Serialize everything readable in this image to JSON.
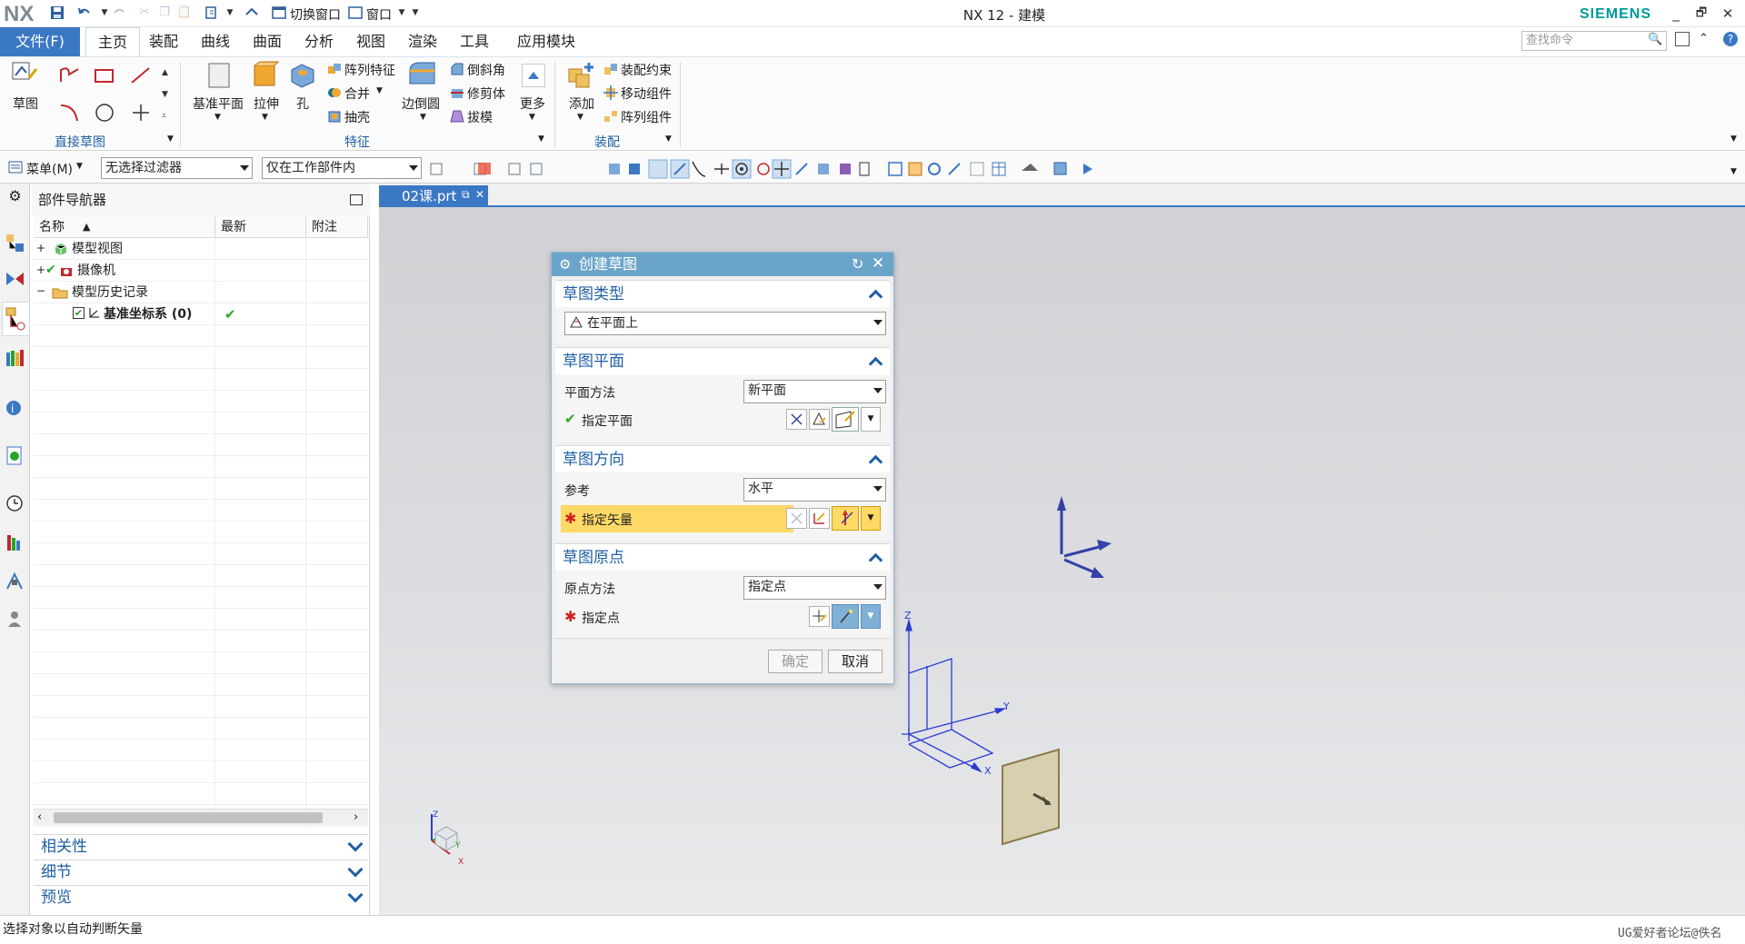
{
  "app": {
    "logo": "NX",
    "title": "NX 12 - 建模",
    "brand": "SIEMENS"
  },
  "quick_access": {
    "switch_window": "切换窗口",
    "window": "窗口"
  },
  "menu_tabs": {
    "file": "文件(F)",
    "items": [
      "主页",
      "装配",
      "曲线",
      "曲面",
      "分析",
      "视图",
      "渲染",
      "工具",
      "应用模块"
    ]
  },
  "search": {
    "placeholder": "查找命令"
  },
  "ribbon": {
    "sketch": {
      "label": "草图"
    },
    "direct_sketch": {
      "label": "直接草图"
    },
    "feature": {
      "label": "特征",
      "datum_plane": "基准平面",
      "extrude": "拉伸",
      "hole": "孔",
      "pattern_feature": "阵列特征",
      "unite": "合并",
      "shell": "抽壳",
      "edge_blend": "边倒圆",
      "chamfer": "倒斜角",
      "trim_body": "修剪体",
      "draft": "拔模",
      "more": "更多"
    },
    "assembly": {
      "label": "装配",
      "add": "添加",
      "assembly_constraint": "装配约束",
      "move_component": "移动组件",
      "pattern_component": "阵列组件"
    }
  },
  "selection_bar": {
    "menu": "菜单(M)",
    "filter": "无选择过滤器",
    "scope": "仅在工作部件内"
  },
  "navigator": {
    "title": "部件导航器",
    "columns": [
      "名称",
      "最新",
      "附注"
    ],
    "items": [
      {
        "label": "模型视图"
      },
      {
        "label": "摄像机"
      },
      {
        "label": "模型历史记录"
      },
      {
        "label": "基准坐标系 (0)"
      }
    ],
    "sections": [
      "相关性",
      "细节",
      "预览"
    ]
  },
  "doc_tab": {
    "label": "02课.prt"
  },
  "dialog": {
    "title": "创建草图",
    "sketch_type": {
      "header": "草图类型",
      "value": "在平面上"
    },
    "sketch_plane": {
      "header": "草图平面",
      "method_label": "平面方法",
      "method_value": "新平面",
      "specify_plane": "指定平面"
    },
    "sketch_orientation": {
      "header": "草图方向",
      "reference_label": "参考",
      "reference_value": "水平",
      "specify_vector": "指定矢量"
    },
    "sketch_origin": {
      "header": "草图原点",
      "method_label": "原点方法",
      "method_value": "指定点",
      "specify_point": "指定点"
    },
    "ok": "确定",
    "cancel": "取消"
  },
  "triad": {
    "z": "Z",
    "y": "Y",
    "x": "X"
  },
  "status": {
    "message": "选择对象以自动判断矢量",
    "watermark": "UG爱好者论坛@佚名"
  },
  "colors": {
    "accent": "#3b78c4",
    "dialog_title": "#6ba4c9",
    "highlight": "#ffd966",
    "required": "#d02020",
    "check": "#2aa22a"
  }
}
